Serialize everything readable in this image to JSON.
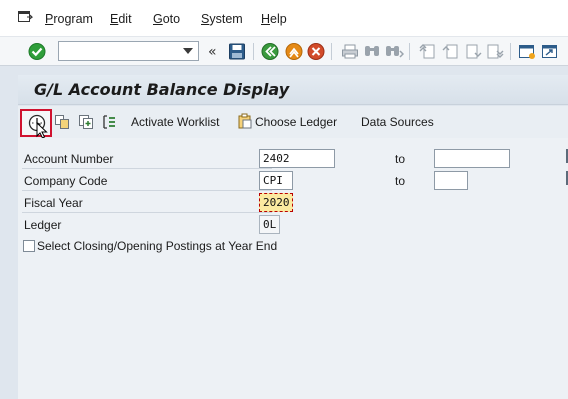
{
  "menu": {
    "items": [
      "Program",
      "Edit",
      "Goto",
      "System",
      "Help"
    ]
  },
  "toolbar": {
    "command_field_value": "",
    "icons": [
      "enter-check-icon",
      "command-field-dropdown",
      "expand-chevron-icon",
      "save-icon",
      "back-icon",
      "exit-icon",
      "cancel-icon",
      "print-icon",
      "find-icon",
      "find-next-icon",
      "first-page-icon",
      "previous-page-icon",
      "next-page-icon",
      "last-page-icon",
      "create-session-icon",
      "shortcut-icon"
    ],
    "chevron": "«"
  },
  "title": "G/L Account Balance Display",
  "app_toolbar": {
    "activate_worklist": "Activate Worklist",
    "choose_ledger": "Choose Ledger",
    "data_sources": "Data Sources"
  },
  "form": {
    "account_number": {
      "label": "Account Number",
      "value": "2402",
      "to_label": "to",
      "to_value": ""
    },
    "company_code": {
      "label": "Company Code",
      "value": "CPI",
      "to_label": "to",
      "to_value": ""
    },
    "fiscal_year": {
      "label": "Fiscal Year",
      "value": "2020"
    },
    "ledger": {
      "label": "Ledger",
      "value": "0L"
    },
    "closing_checkbox": {
      "label": "Select Closing/Opening Postings at Year End",
      "checked": false
    }
  },
  "colors": {
    "accent_red": "#d0122f",
    "focus_field": "#fbeaa0",
    "enter_green": "#2f9e3a",
    "exit_orange": "#e58a17",
    "cancel_red": "#d24b2a"
  }
}
